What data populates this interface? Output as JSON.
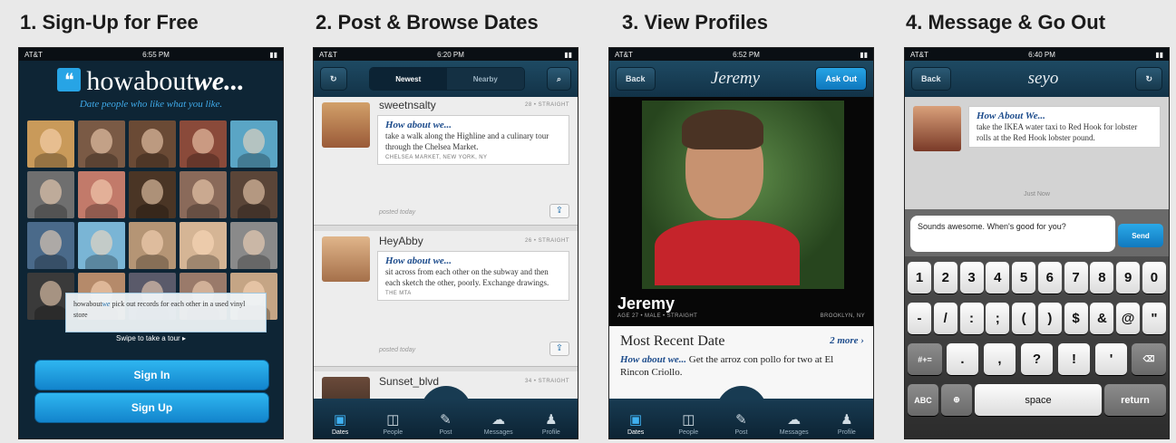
{
  "panels": {
    "p1": {
      "title": "1. Sign-Up for Free"
    },
    "p2": {
      "title": "2. Post & Browse Dates"
    },
    "p3": {
      "title": "3. View Profiles"
    },
    "p4": {
      "title": "4. Message & Go Out"
    }
  },
  "status": {
    "carrier": "AT&T",
    "t1": "6:55 PM",
    "t2": "6:20 PM",
    "t3": "6:52 PM",
    "t4": "6:40 PM"
  },
  "signup": {
    "logo_how": "howabout",
    "logo_we": "we...",
    "tagline": "Date people who like what you like.",
    "bubble_brand_a": "howabout",
    "bubble_brand_b": "we",
    "bubble_text": " pick out records for each other in a used vinyl store",
    "swipe_hint": "Swipe to take a tour",
    "sign_in": "Sign In",
    "sign_up": "Sign Up",
    "face_colors": [
      "#c99a5a",
      "#7a5a45",
      "#6a4a35",
      "#8a4a3a",
      "#5aa5c5",
      "#6f6f6f",
      "#c27a6a",
      "#4a3525",
      "#8a6a5a",
      "#5a4538",
      "#4a6a8a",
      "#7ab5d5",
      "#b59575",
      "#d5b595",
      "#8a8a8a",
      "#3a3a3a",
      "#b58a6a",
      "#5a5a6a",
      "#9a7a6a",
      "#c5a585"
    ]
  },
  "browse": {
    "seg_newest": "Newest",
    "seg_nearby": "Nearby",
    "cards": [
      {
        "user": "sweetnsalty",
        "meta": "28 • STRAIGHT",
        "how": "How about we...",
        "text": "take a walk along the Highline and a culinary tour through the Chelsea Market.",
        "loc": "CHELSEA MARKET, NEW YORK, NY",
        "posted": "posted today"
      },
      {
        "user": "HeyAbby",
        "meta": "26 • STRAIGHT",
        "how": "How about we...",
        "text": "sit across from each other on the subway and then each sketch the other, poorly. Exchange drawings.",
        "loc": "THE MTA",
        "posted": "posted today"
      },
      {
        "user": "Sunset_blvd",
        "meta": "34 • STRAIGHT"
      }
    ]
  },
  "tabs": [
    "Dates",
    "People",
    "Post",
    "Messages",
    "Profile"
  ],
  "profile": {
    "back": "Back",
    "title": "Jeremy",
    "ask_out": "Ask Out",
    "name": "Jeremy",
    "meta": "AGE 27 • MALE • STRAIGHT",
    "location": "BROOKLYN, NY",
    "recent_title": "Most Recent Date",
    "more": "2 more",
    "how": "How about we...",
    "recent_text": " Get the arroz con pollo for two at El Rincon Criollo."
  },
  "message": {
    "back": "Back",
    "title": "seyo",
    "how": "How About We...",
    "text": "take the IKEA water taxi to Red Hook for lobster rolls at the Red Hook lobster pound.",
    "stamp": "Just Now",
    "input": "Sounds awesome. When's good for you?",
    "send": "Send",
    "keys_row1": [
      "1",
      "2",
      "3",
      "4",
      "5",
      "6",
      "7",
      "8",
      "9",
      "0"
    ],
    "keys_row2": [
      "-",
      "/",
      ":",
      ";",
      "(",
      ")",
      "$",
      "&",
      "@",
      "\""
    ],
    "key_symbols": "#+=",
    "keys_row3": [
      ".",
      ",",
      "?",
      "!",
      "'"
    ],
    "key_abc": "ABC",
    "key_space": "space",
    "key_return": "return"
  }
}
